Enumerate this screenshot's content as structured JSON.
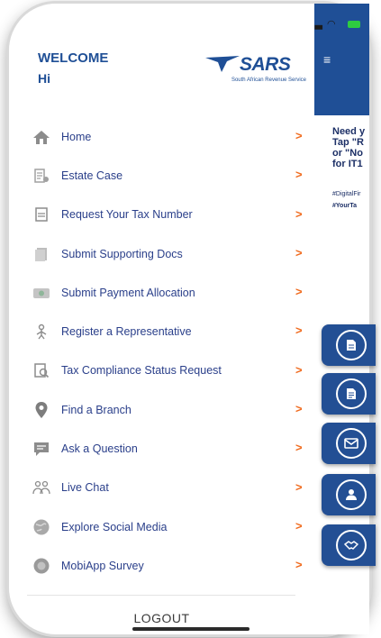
{
  "header": {
    "welcome": "WELCOME",
    "greeting": "Hi",
    "logo_text": "SARS",
    "logo_tagline": "South African Revenue Service"
  },
  "menu": [
    {
      "label": "Home",
      "icon": "home-icon"
    },
    {
      "label": "Estate Case",
      "icon": "estate-icon"
    },
    {
      "label": "Request Your Tax Number",
      "icon": "document-icon"
    },
    {
      "label": "Submit Supporting Docs",
      "icon": "docs-icon"
    },
    {
      "label": "Submit Payment Allocation",
      "icon": "payment-icon"
    },
    {
      "label": "Register a Representative",
      "icon": "person-icon"
    },
    {
      "label": "Tax Compliance Status Request",
      "icon": "compliance-icon"
    },
    {
      "label": "Find a Branch",
      "icon": "location-pin-icon"
    },
    {
      "label": "Ask a Question",
      "icon": "speech-bubble-icon"
    },
    {
      "label": "Live Chat",
      "icon": "chat-people-icon"
    },
    {
      "label": "Explore Social Media",
      "icon": "globe-icon"
    },
    {
      "label": "MobiApp Survey",
      "icon": "survey-icon"
    }
  ],
  "chevron": ">",
  "logout": "LOGOUT",
  "background_app": {
    "menu_glyph": "≡",
    "promo_lines": [
      "Need y",
      "Tap \"R",
      "or \"No",
      "for IT1"
    ],
    "tags": [
      "#DigitalFir",
      "#YourTa"
    ],
    "fab_icons": [
      "file-icon",
      "document-icon",
      "mail-icon",
      "person-icon",
      "handshake-icon"
    ]
  },
  "colors": {
    "brand_blue": "#1f4f96",
    "chevron_orange": "#f06a1d",
    "label_blue": "#2a3f8a"
  }
}
